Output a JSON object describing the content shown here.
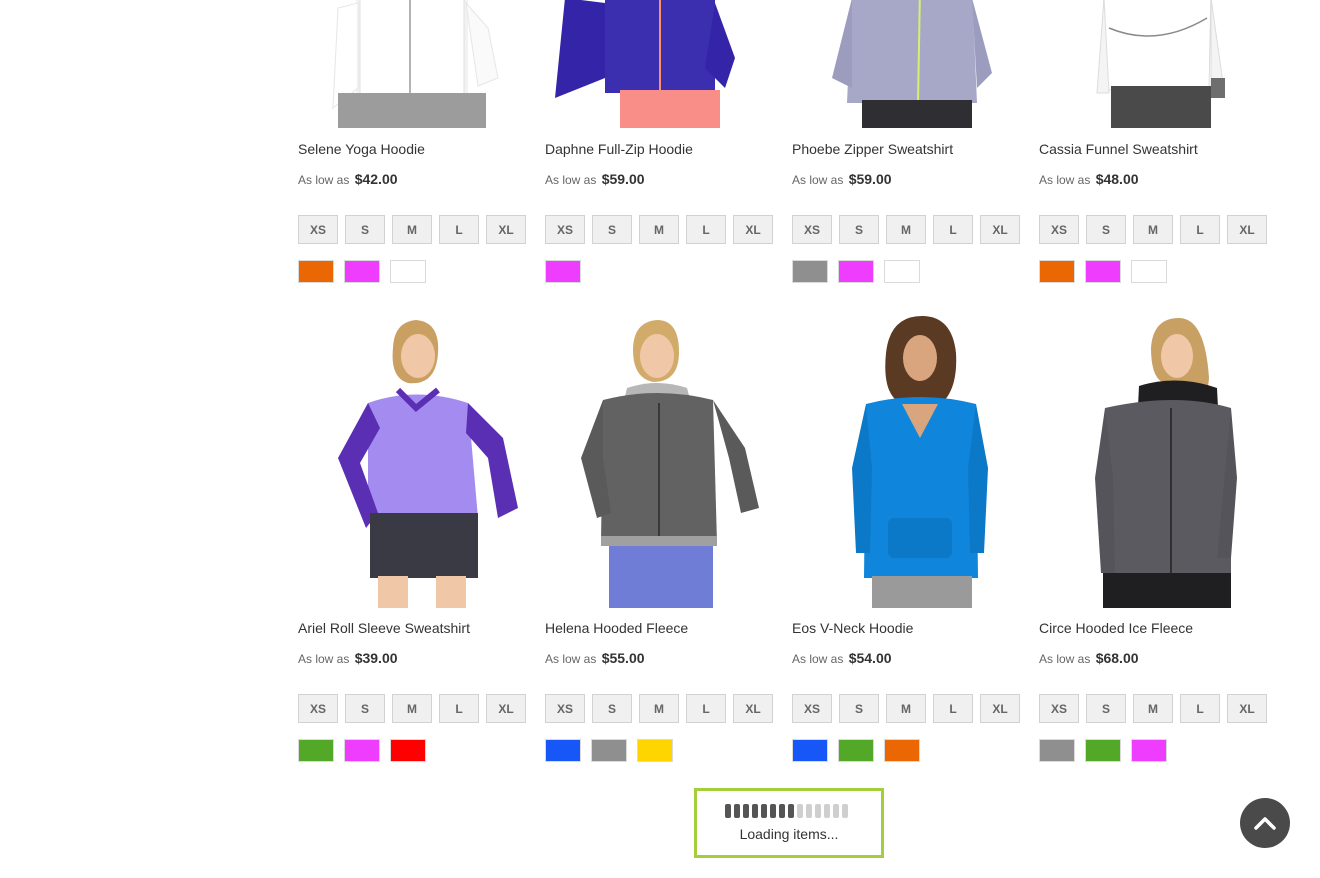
{
  "products": [
    {
      "name": "Selene Yoga Hoodie",
      "price_prefix": "As low as",
      "price": "$42.00",
      "sizes": [
        "XS",
        "S",
        "M",
        "L",
        "XL"
      ],
      "swatches": [
        "#eb6703",
        "#ef3dff",
        "#ffffff"
      ]
    },
    {
      "name": "Daphne Full-Zip Hoodie",
      "price_prefix": "As low as",
      "price": "$59.00",
      "sizes": [
        "XS",
        "S",
        "M",
        "L",
        "XL"
      ],
      "swatches": [
        "#ef3dff"
      ]
    },
    {
      "name": "Phoebe Zipper Sweatshirt",
      "price_prefix": "As low as",
      "price": "$59.00",
      "sizes": [
        "XS",
        "S",
        "M",
        "L",
        "XL"
      ],
      "swatches": [
        "#8f8f8f",
        "#ef3dff",
        "#ffffff"
      ]
    },
    {
      "name": "Cassia Funnel Sweatshirt",
      "price_prefix": "As low as",
      "price": "$48.00",
      "sizes": [
        "XS",
        "S",
        "M",
        "L",
        "XL"
      ],
      "swatches": [
        "#eb6703",
        "#ef3dff",
        "#ffffff"
      ]
    },
    {
      "name": "Ariel Roll Sleeve Sweatshirt",
      "price_prefix": "As low as",
      "price": "$39.00",
      "sizes": [
        "XS",
        "S",
        "M",
        "L",
        "XL"
      ],
      "swatches": [
        "#53a828",
        "#ef3dff",
        "#ff0000"
      ]
    },
    {
      "name": "Helena Hooded Fleece",
      "price_prefix": "As low as",
      "price": "$55.00",
      "sizes": [
        "XS",
        "S",
        "M",
        "L",
        "XL"
      ],
      "swatches": [
        "#1857f7",
        "#8f8f8f",
        "#ffd500"
      ]
    },
    {
      "name": "Eos V-Neck Hoodie",
      "price_prefix": "As low as",
      "price": "$54.00",
      "sizes": [
        "XS",
        "S",
        "M",
        "L",
        "XL"
      ],
      "swatches": [
        "#1857f7",
        "#53a828",
        "#eb6703"
      ]
    },
    {
      "name": "Circe Hooded Ice Fleece",
      "price_prefix": "As low as",
      "price": "$68.00",
      "sizes": [
        "XS",
        "S",
        "M",
        "L",
        "XL"
      ],
      "swatches": [
        "#8f8f8f",
        "#53a828",
        "#ef3dff"
      ]
    }
  ],
  "loader": {
    "text": "Loading items..."
  },
  "colors": {
    "loader_border": "#a4cf3a",
    "to_top_bg": "#4a4a4a"
  },
  "icons": {
    "to_top": "chevron-up-icon"
  }
}
